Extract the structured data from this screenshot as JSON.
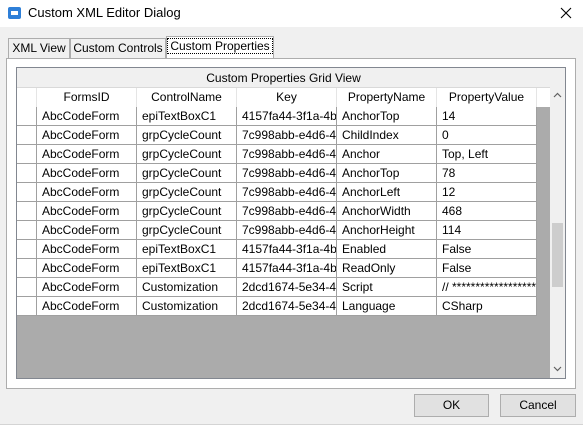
{
  "window": {
    "title": "Custom XML Editor Dialog"
  },
  "tabs": [
    {
      "label": "XML View"
    },
    {
      "label": "Custom Controls"
    },
    {
      "label": "Custom Properties"
    }
  ],
  "grid": {
    "caption": "Custom Properties Grid View",
    "columns": [
      "FormsID",
      "ControlName",
      "Key",
      "PropertyName",
      "PropertyValue"
    ],
    "rows": [
      [
        "AbcCodeForm",
        "epiTextBoxC1",
        "4157fa44-3f1a-4b",
        "AnchorTop",
        "14"
      ],
      [
        "AbcCodeForm",
        "grpCycleCount",
        "7c998abb-e4d6-4",
        "ChildIndex",
        "0"
      ],
      [
        "AbcCodeForm",
        "grpCycleCount",
        "7c998abb-e4d6-4",
        "Anchor",
        "Top, Left"
      ],
      [
        "AbcCodeForm",
        "grpCycleCount",
        "7c998abb-e4d6-4",
        "AnchorTop",
        "78"
      ],
      [
        "AbcCodeForm",
        "grpCycleCount",
        "7c998abb-e4d6-4",
        "AnchorLeft",
        "12"
      ],
      [
        "AbcCodeForm",
        "grpCycleCount",
        "7c998abb-e4d6-4",
        "AnchorWidth",
        "468"
      ],
      [
        "AbcCodeForm",
        "grpCycleCount",
        "7c998abb-e4d6-4",
        "AnchorHeight",
        "114"
      ],
      [
        "AbcCodeForm",
        "epiTextBoxC1",
        "4157fa44-3f1a-4b",
        "Enabled",
        "False"
      ],
      [
        "AbcCodeForm",
        "epiTextBoxC1",
        "4157fa44-3f1a-4b",
        "ReadOnly",
        "False"
      ],
      [
        "AbcCodeForm",
        "Customization",
        "2dcd1674-5e34-4",
        "Script",
        "// **********************"
      ],
      [
        "AbcCodeForm",
        "Customization",
        "2dcd1674-5e34-4",
        "Language",
        "CSharp"
      ]
    ]
  },
  "buttons": {
    "ok": "OK",
    "cancel": "Cancel"
  },
  "icons": {
    "app": "app-icon",
    "close": "close-icon",
    "scroll_up": "chevron-up-icon",
    "scroll_down": "chevron-down-icon"
  },
  "colors": {
    "app_icon": "#2e7fd8",
    "grid_background": "#ababab",
    "grid_lines": "#a0a0a0"
  }
}
